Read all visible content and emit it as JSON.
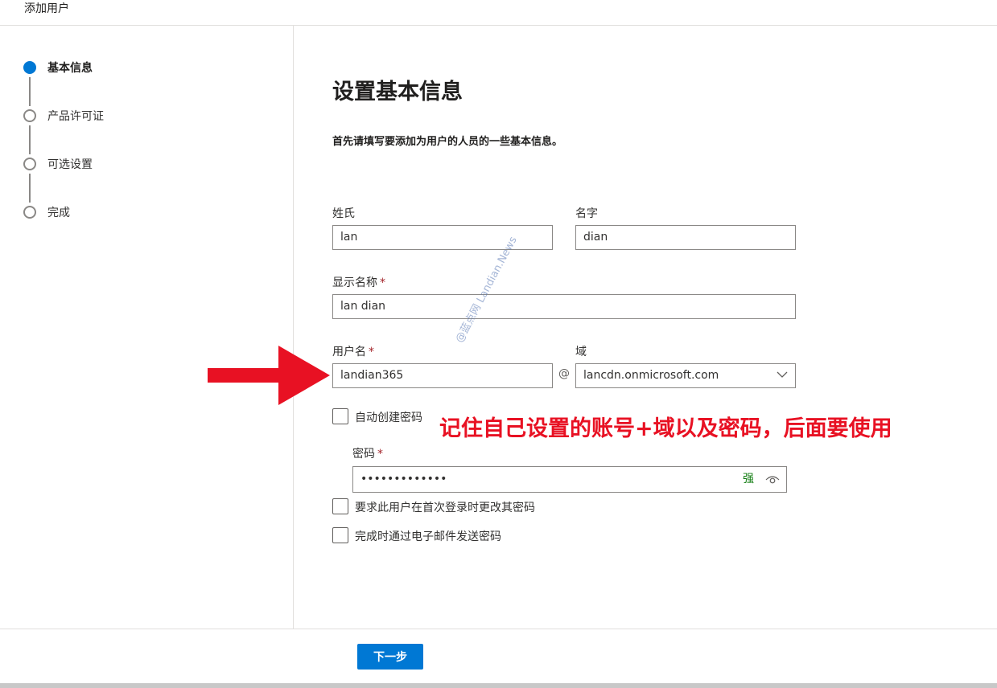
{
  "page": {
    "title": "添加用户"
  },
  "steps": [
    {
      "label": "基本信息",
      "active": true
    },
    {
      "label": "产品许可证",
      "active": false
    },
    {
      "label": "可选设置",
      "active": false
    },
    {
      "label": "完成",
      "active": false
    }
  ],
  "main": {
    "heading": "设置基本信息",
    "description": "首先请填写要添加为用户的人员的一些基本信息。"
  },
  "form": {
    "last_name": {
      "label": "姓氏",
      "value": "lan"
    },
    "first_name": {
      "label": "名字",
      "value": "dian"
    },
    "display_name": {
      "label": "显示名称",
      "required_mark": "*",
      "value": "lan dian"
    },
    "username": {
      "label": "用户名",
      "required_mark": "*",
      "value": "landian365"
    },
    "at_sign": "@",
    "domain": {
      "label": "域",
      "value": "lancdn.onmicrosoft.com"
    },
    "auto_password": {
      "label": "自动创建密码",
      "checked": false
    },
    "password": {
      "label": "密码",
      "required_mark": "*",
      "value": "•••••••••••••",
      "strength": "强"
    },
    "require_change": {
      "label": "要求此用户在首次登录时更改其密码",
      "checked": false
    },
    "email_password": {
      "label": "完成时通过电子邮件发送密码",
      "checked": false
    }
  },
  "annotation": {
    "text": "记住自己设置的账号+域以及密码，后面要使用"
  },
  "watermark": {
    "text": "@蓝点网 Landian.News"
  },
  "footer": {
    "next_label": "下一步"
  },
  "colors": {
    "accent": "#0078d4",
    "annotation": "#e81123",
    "strength": "#107c10"
  }
}
